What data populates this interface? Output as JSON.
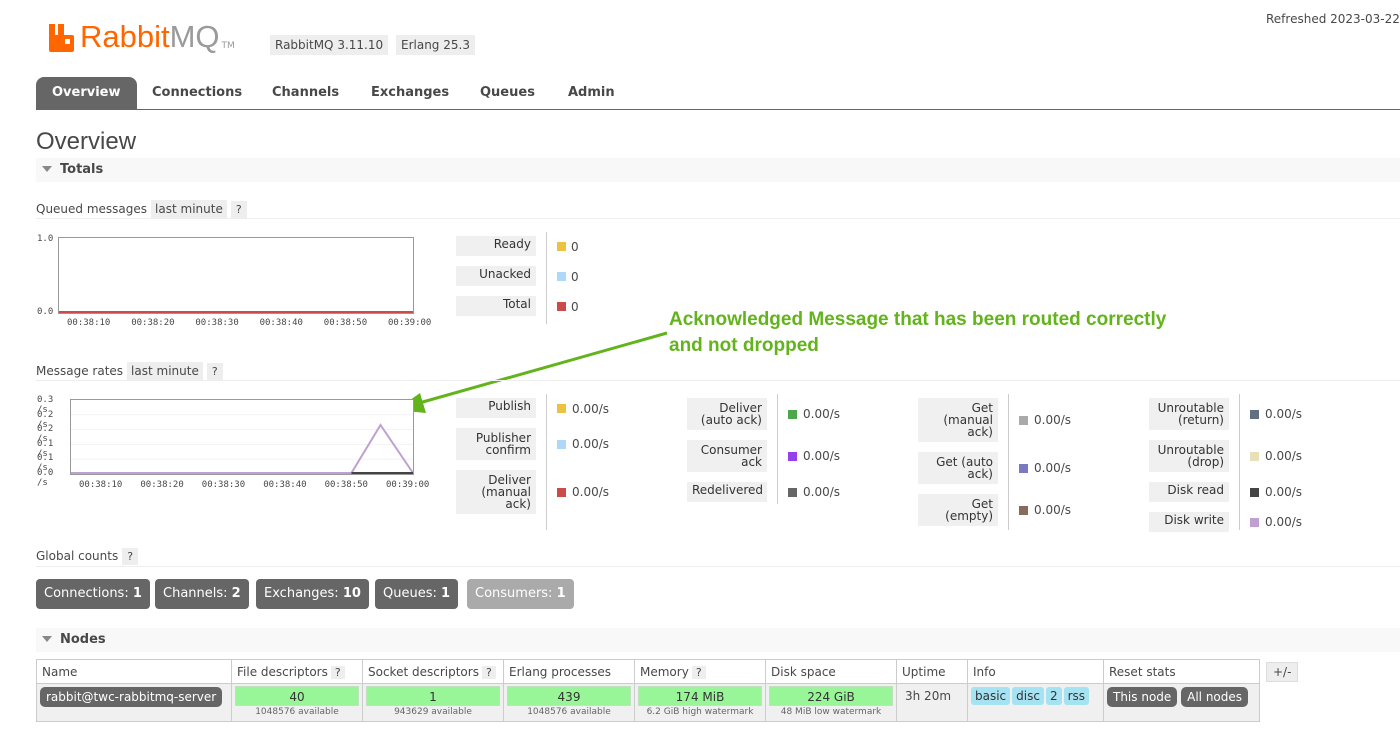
{
  "header": {
    "logo_rabbit": "Rabbit",
    "logo_mq": "MQ",
    "logo_tm": "TM",
    "rabbitmq_version": "RabbitMQ 3.11.10",
    "erlang_version": "Erlang 25.3",
    "refreshed": "Refreshed 2023-03-22"
  },
  "tabs": [
    {
      "label": "Overview",
      "active": true
    },
    {
      "label": "Connections"
    },
    {
      "label": "Channels"
    },
    {
      "label": "Exchanges"
    },
    {
      "label": "Queues"
    },
    {
      "label": "Admin"
    }
  ],
  "page_title": "Overview",
  "totals": {
    "section_title": "Totals",
    "queued_label": "Queued messages",
    "queued_range": "last minute",
    "help": "?",
    "rates_label": "Message rates",
    "rates_range": "last minute"
  },
  "queued_legend": [
    {
      "label": "Ready",
      "value": "0",
      "color": "#edc240"
    },
    {
      "label": "Unacked",
      "value": "0",
      "color": "#afd8f8"
    },
    {
      "label": "Total",
      "value": "0",
      "color": "#cb4b4b"
    }
  ],
  "rates_legend": [
    [
      {
        "label": "Publish",
        "value": "0.00/s",
        "color": "#edc240"
      },
      {
        "label": "Publisher confirm",
        "value": "0.00/s",
        "color": "#afd8f8"
      },
      {
        "label": "Deliver (manual ack)",
        "value": "0.00/s",
        "color": "#cb4b4b"
      }
    ],
    [
      {
        "label": "Deliver (auto ack)",
        "value": "0.00/s",
        "color": "#4da74d"
      },
      {
        "label": "Consumer ack",
        "value": "0.00/s",
        "color": "#9440ed"
      },
      {
        "label": "Redelivered",
        "value": "0.00/s",
        "color": "#666666"
      }
    ],
    [
      {
        "label": "Get (manual ack)",
        "value": "0.00/s",
        "color": "#aaaaaa"
      },
      {
        "label": "Get (auto ack)",
        "value": "0.00/s",
        "color": "#7c79c3"
      },
      {
        "label": "Get (empty)",
        "value": "0.00/s",
        "color": "#8a6a5a"
      }
    ],
    [
      {
        "label": "Unroutable (return)",
        "value": "0.00/s",
        "color": "#607080"
      },
      {
        "label": "Unroutable (drop)",
        "value": "0.00/s",
        "color": "#e8e0b8"
      },
      {
        "label": "Disk read",
        "value": "0.00/s",
        "color": "#444444"
      },
      {
        "label": "Disk write",
        "value": "0.00/s",
        "color": "#c0a0d0"
      }
    ]
  ],
  "annotation": {
    "line1": "Acknowledged Message that has been routed correctly",
    "line2": "and not dropped",
    "color": "#63b41c"
  },
  "queued_chart": {
    "type": "line",
    "x": [
      "00:38:10",
      "00:38:20",
      "00:38:30",
      "00:38:40",
      "00:38:50",
      "00:39:00"
    ],
    "y_ticks": [
      "1.0",
      "0.0"
    ],
    "ylim": [
      0,
      1
    ],
    "series": [
      {
        "name": "Total",
        "color": "#cb4b4b",
        "values": [
          0,
          0,
          0,
          0,
          0,
          0
        ]
      }
    ]
  },
  "rates_chart": {
    "type": "line",
    "x": [
      "00:38:10",
      "00:38:20",
      "00:38:30",
      "00:38:40",
      "00:38:50",
      "00:39:00"
    ],
    "y_ticks": [
      "0.3 /s",
      "0.2 /s",
      "0.2 /s",
      "0.1 /s",
      "0.1 /s",
      "0.0 /s"
    ],
    "ylim": [
      0,
      0.3
    ],
    "series": [
      {
        "name": "Disk write",
        "color": "#c0a0d0",
        "points": [
          [
            0,
            0
          ],
          [
            0.82,
            0
          ],
          [
            0.905,
            0.2
          ],
          [
            1,
            0
          ]
        ]
      },
      {
        "name": "Disk read",
        "color": "#444444",
        "points": [
          [
            0.82,
            0
          ],
          [
            1,
            0
          ]
        ]
      }
    ]
  },
  "global_counts": {
    "label": "Global counts",
    "help": "?",
    "items": [
      {
        "label": "Connections:",
        "value": "1"
      },
      {
        "label": "Channels:",
        "value": "2"
      },
      {
        "label": "Exchanges:",
        "value": "10"
      },
      {
        "label": "Queues:",
        "value": "1"
      },
      {
        "label": "Consumers:",
        "value": "1"
      }
    ]
  },
  "nodes": {
    "section_title": "Nodes",
    "columns": [
      "Name",
      "File descriptors",
      "Socket descriptors",
      "Erlang processes",
      "Memory",
      "Disk space",
      "Uptime",
      "Info",
      "Reset stats"
    ],
    "plus_minus": "+/-",
    "row": {
      "name": "rabbit@twc-rabbitmq-server",
      "file_desc": "40",
      "file_desc_avail": "1048576 available",
      "socket_desc": "1",
      "socket_desc_avail": "943629 available",
      "erlang_proc": "439",
      "erlang_proc_avail": "1048576 available",
      "memory": "174 MiB",
      "memory_note": "6.2 GiB high watermark",
      "disk": "224 GiB",
      "disk_note": "48 MiB low watermark",
      "uptime": "3h 20m",
      "info": [
        "basic",
        "disc",
        "2",
        "rss"
      ],
      "reset_this": "This node",
      "reset_all": "All nodes"
    }
  }
}
